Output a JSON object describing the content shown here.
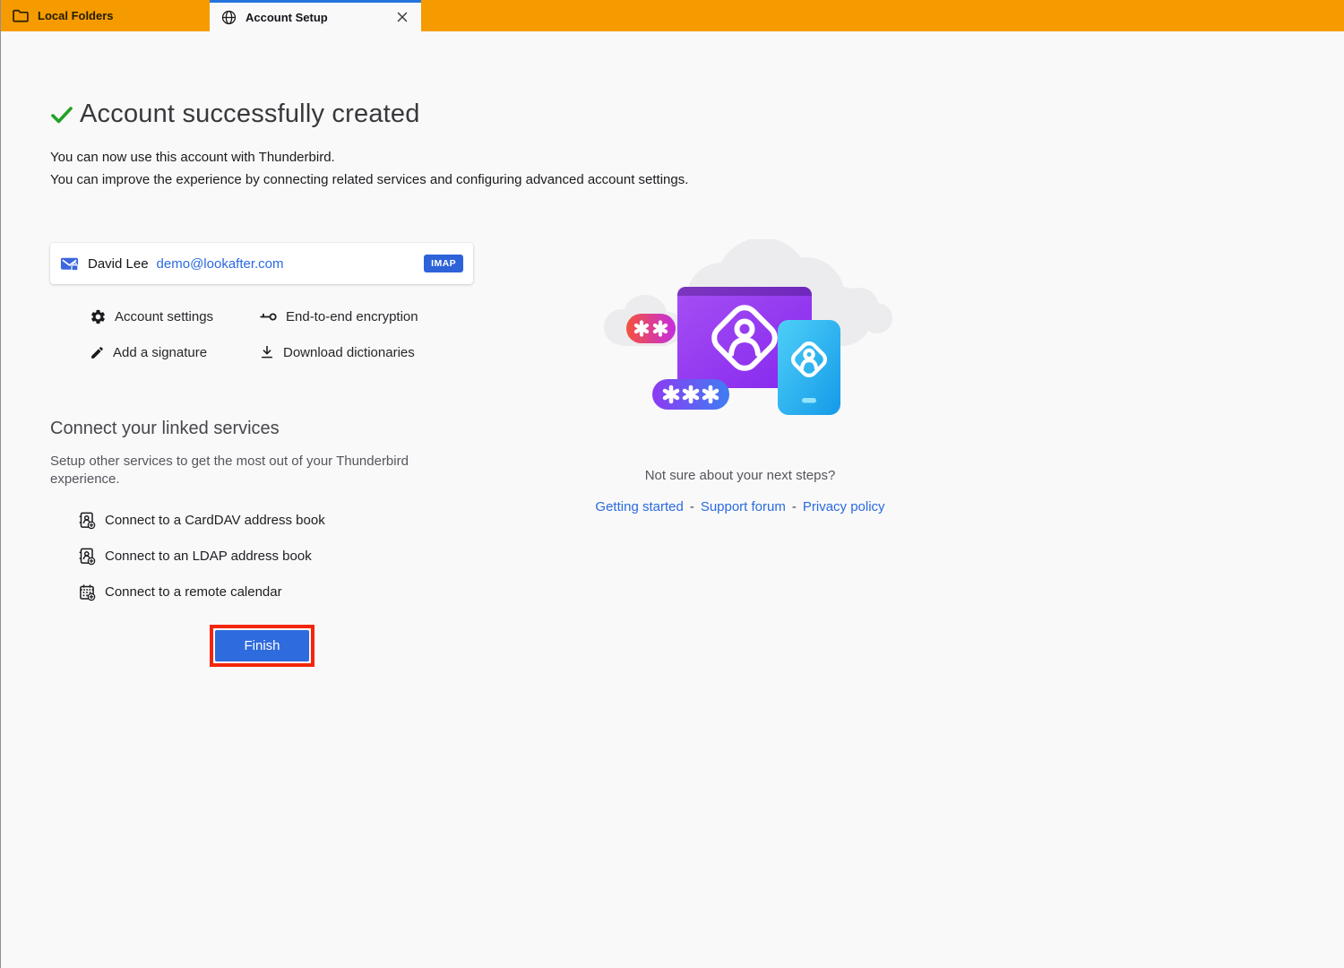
{
  "tabs": {
    "local_folders": {
      "label": "Local Folders"
    },
    "account_setup": {
      "label": "Account Setup"
    }
  },
  "header": {
    "title": "Account successfully created",
    "line1": "You can now use this account with Thunderbird.",
    "line2": "You can improve the experience by connecting related services and configuring advanced account settings."
  },
  "account": {
    "name": "David Lee",
    "email": "demo@lookafter.com",
    "protocol_badge": "IMAP"
  },
  "quick_actions": [
    {
      "icon": "gear-icon",
      "label": "Account settings"
    },
    {
      "icon": "key-icon",
      "label": "End-to-end encryption"
    },
    {
      "icon": "pencil-icon",
      "label": "Add a signature"
    },
    {
      "icon": "download-icon",
      "label": "Download dictionaries"
    }
  ],
  "linked_services": {
    "title": "Connect your linked services",
    "description": "Setup other services to get the most out of your Thunderbird experience.",
    "items": [
      {
        "icon": "address-book-add-icon",
        "label": "Connect to a CardDAV address book"
      },
      {
        "icon": "address-book-add-icon",
        "label": "Connect to an LDAP address book"
      },
      {
        "icon": "calendar-add-icon",
        "label": "Connect to a remote calendar"
      }
    ]
  },
  "finish_button": {
    "label": "Finish"
  },
  "help": {
    "question": "Not sure about your next steps?",
    "separator": "-",
    "links": [
      {
        "label": "Getting started"
      },
      {
        "label": "Support forum"
      },
      {
        "label": "Privacy policy"
      }
    ]
  },
  "illustration": {
    "password_pill_small": "✱✱",
    "password_pill_large": "✱✱✱"
  },
  "colors": {
    "accent_orange": "#f59b00",
    "accent_blue": "#2e6bdd",
    "link_blue": "#2a6ae0",
    "success_green": "#23a127",
    "highlight_red": "#f3260b",
    "tab_active_border": "#2574dd"
  }
}
